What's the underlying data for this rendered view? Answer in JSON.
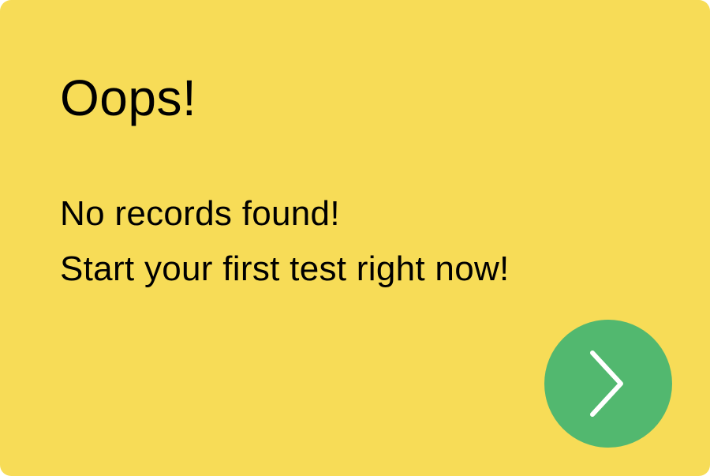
{
  "card": {
    "background_color": "#f7dc57",
    "title": "Oops!",
    "message_line_1": "No records found!",
    "message_line_2": "Start your first test right now!"
  },
  "next_button": {
    "icon": "chevron-right-icon",
    "color": "#52b86f",
    "icon_color": "#ffffff"
  }
}
